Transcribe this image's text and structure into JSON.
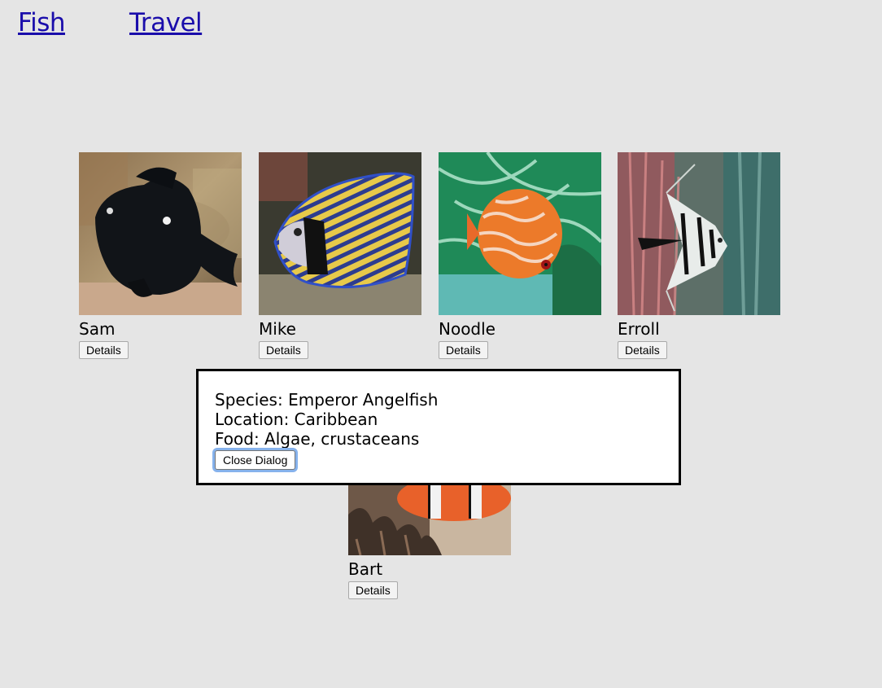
{
  "nav": {
    "fish": "Fish",
    "travel": "Travel"
  },
  "fish": [
    {
      "name": "Sam",
      "details_label": "Details",
      "photo_icon": "black-damselfish-photo"
    },
    {
      "name": "Mike",
      "details_label": "Details",
      "photo_icon": "emperor-angelfish-photo"
    },
    {
      "name": "Noodle",
      "details_label": "Details",
      "photo_icon": "discus-fish-photo"
    },
    {
      "name": "Erroll",
      "details_label": "Details",
      "photo_icon": "freshwater-angelfish-photo"
    },
    {
      "name": "Bart",
      "details_label": "Details",
      "photo_icon": "clownfish-photo"
    }
  ],
  "dialog": {
    "species": "Species: Emperor Angelfish",
    "location": "Location: Caribbean",
    "food": "Food: Algae, crustaceans",
    "close_label": "Close Dialog"
  },
  "colors": {
    "background": "#e5e5e5",
    "link": "#1a0dab",
    "focus_ring": "#86b2ec"
  }
}
